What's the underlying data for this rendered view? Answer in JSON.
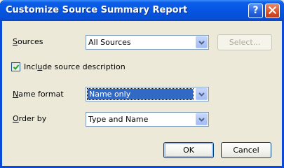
{
  "window": {
    "title": "Customize Source Summary Report",
    "help_glyph": "?",
    "close_icon": "close-icon"
  },
  "sources": {
    "label_accel": "S",
    "label_rest": "ources",
    "value": "All Sources",
    "select_button": "Select..."
  },
  "include_description": {
    "checked": true,
    "label_pre": "Incl",
    "label_accel": "u",
    "label_rest": "de source description"
  },
  "name_format": {
    "label_accel": "N",
    "label_rest": "ame format",
    "value": "Name only"
  },
  "order_by": {
    "label_accel": "O",
    "label_rest": "rder by",
    "value": "Type and Name"
  },
  "buttons": {
    "ok": "OK",
    "cancel": "Cancel"
  },
  "colors": {
    "titlebar": "#0556e3",
    "selection": "#316ac5",
    "dialog_bg": "#ece9d8"
  }
}
